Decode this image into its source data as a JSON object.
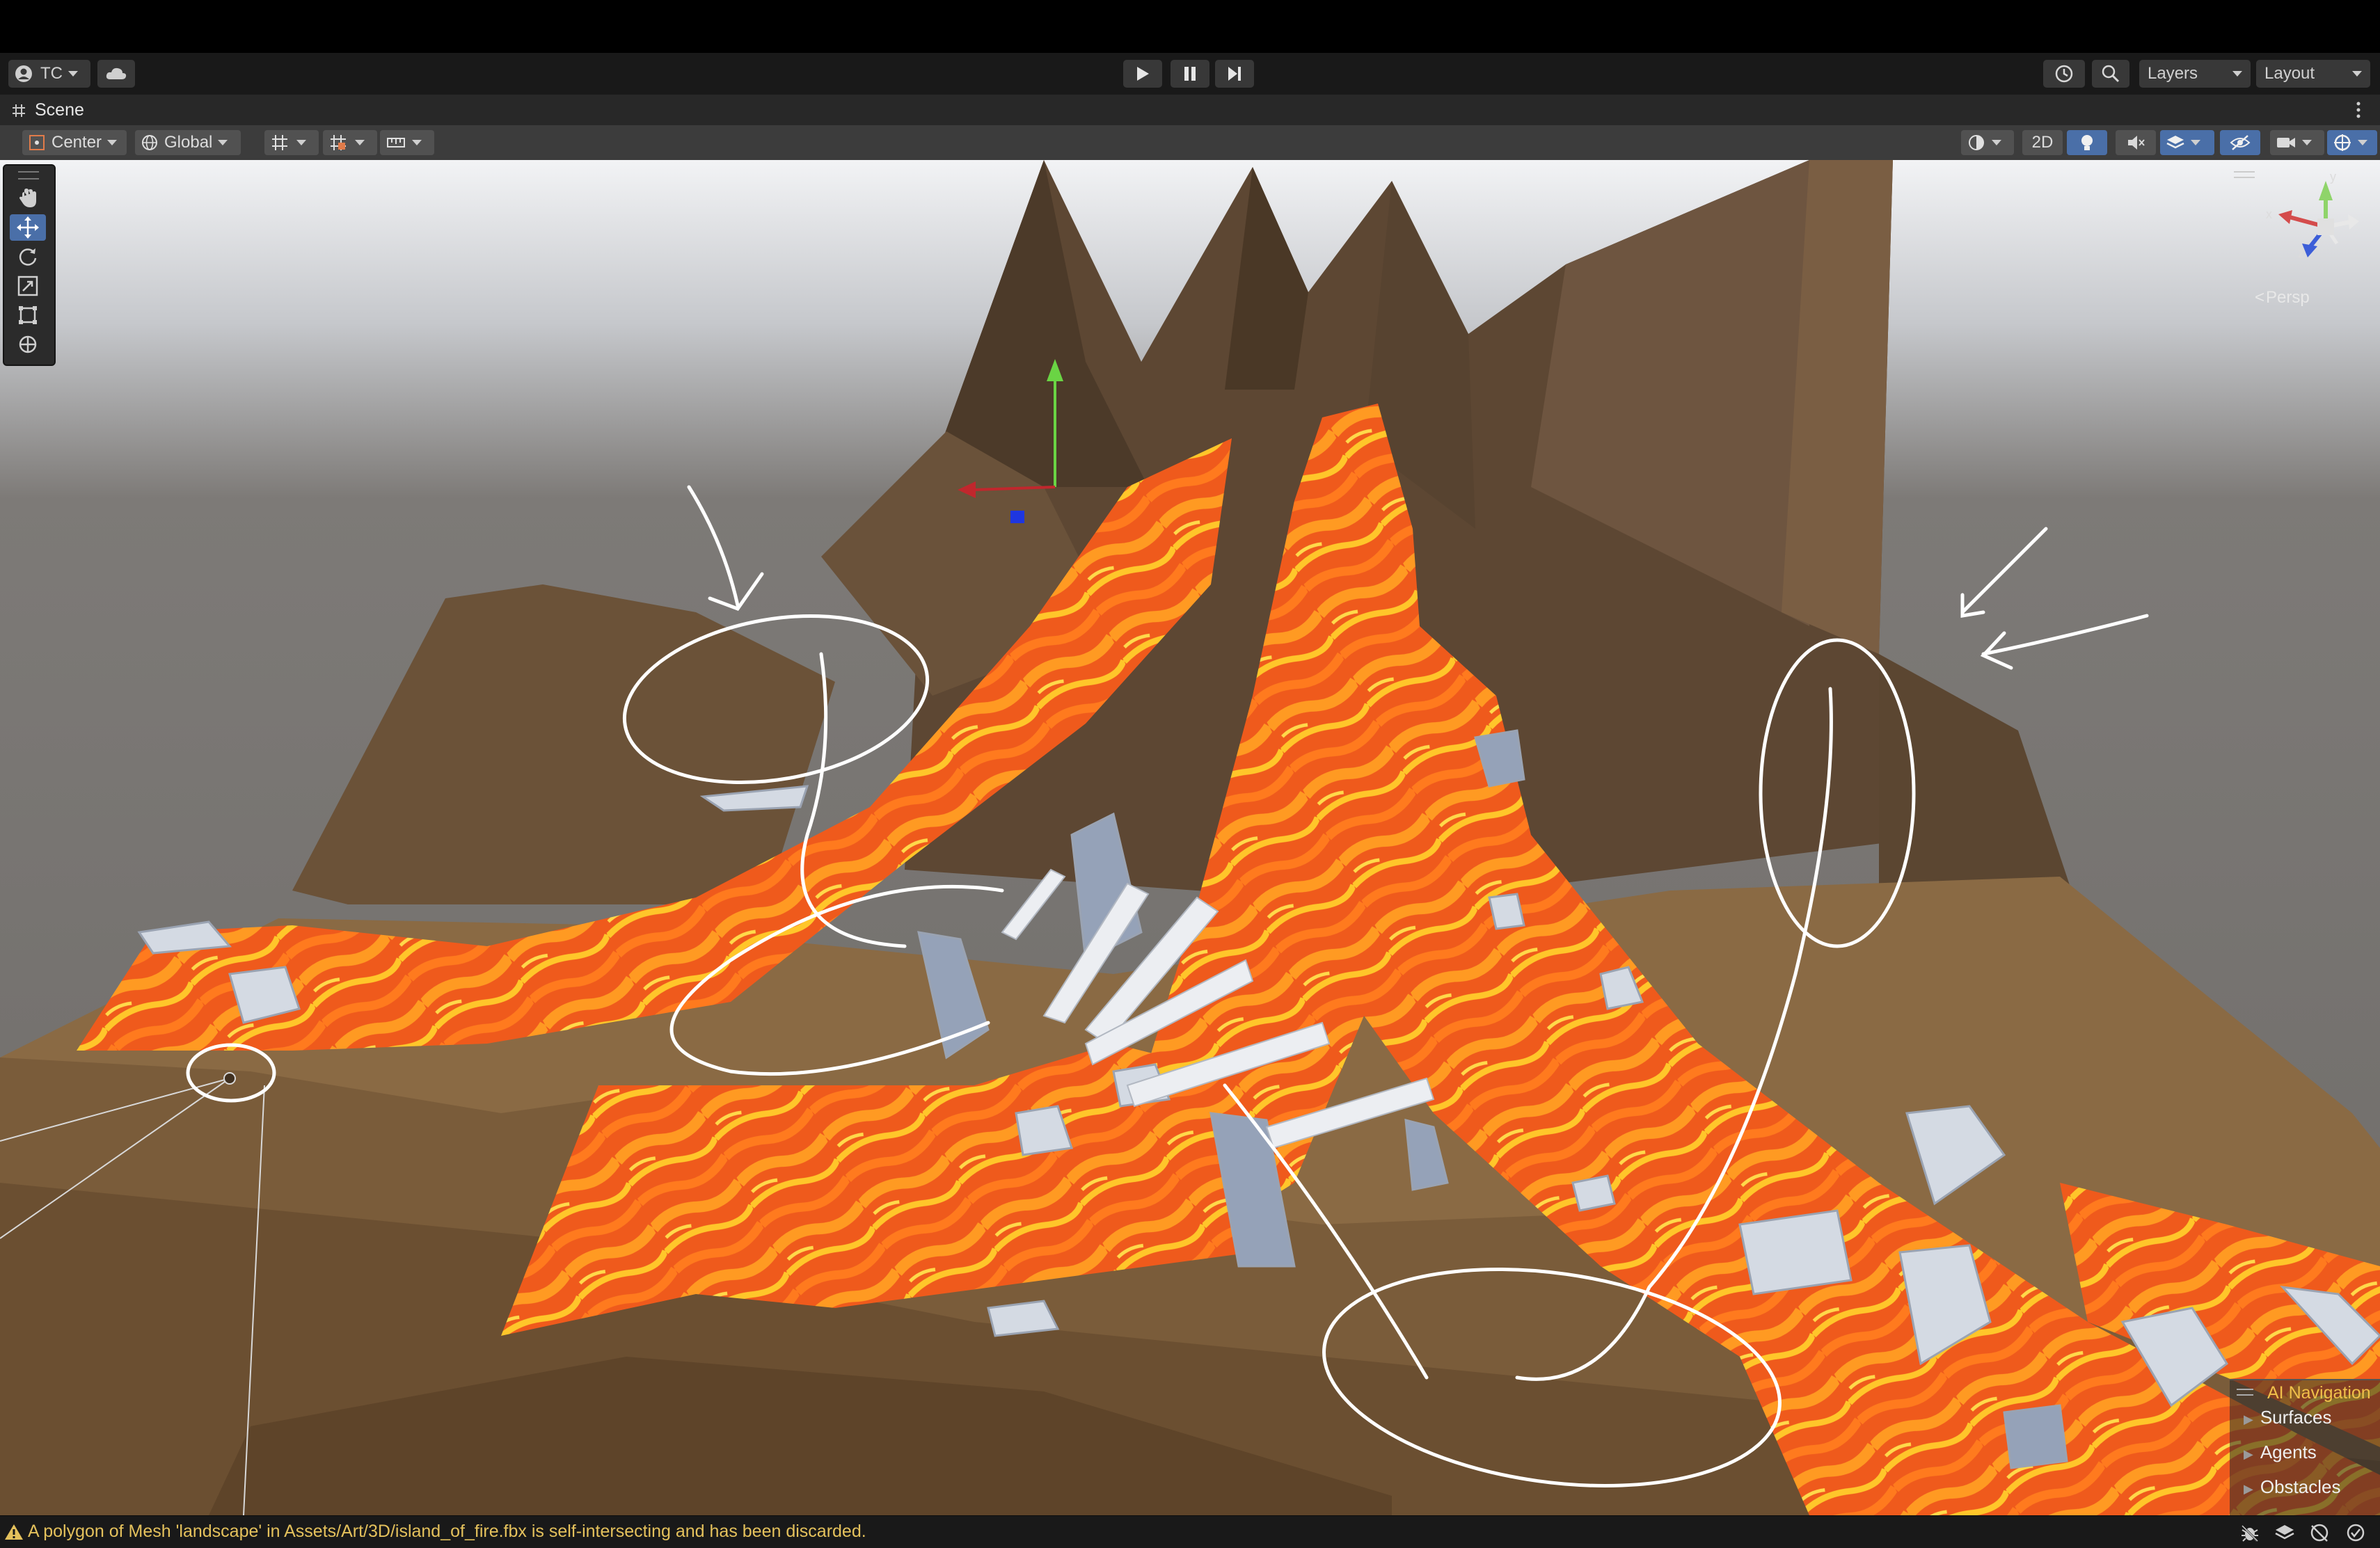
{
  "account": {
    "label": "TC"
  },
  "toolbar": {
    "play_label": "Play",
    "pause_label": "Pause",
    "step_label": "Step",
    "layers_label": "Layers",
    "layout_label": "Layout"
  },
  "scene_tab": {
    "title": "Scene"
  },
  "scene_toolbar": {
    "pivot_label": "Center",
    "space_label": "Global",
    "mode_2d_label": "2D"
  },
  "gizmo": {
    "projection_label": "Persp",
    "axis_x": "x",
    "axis_y": "y",
    "axis_z": "z"
  },
  "ai_navigation": {
    "title": "AI Navigation",
    "items": [
      {
        "label": "Surfaces"
      },
      {
        "label": "Agents"
      },
      {
        "label": "Obstacles"
      }
    ]
  },
  "status": {
    "message": "A polygon of Mesh 'landscape' in Assets/Art/3D/island_of_fire.fbx is self-intersecting and has been discarded."
  },
  "colors": {
    "accent": "#4a6fa8",
    "lava": "#f0641e",
    "lava_hot": "#ffb420",
    "terrain": "#8a6a44",
    "warning": "#e4c15c"
  }
}
